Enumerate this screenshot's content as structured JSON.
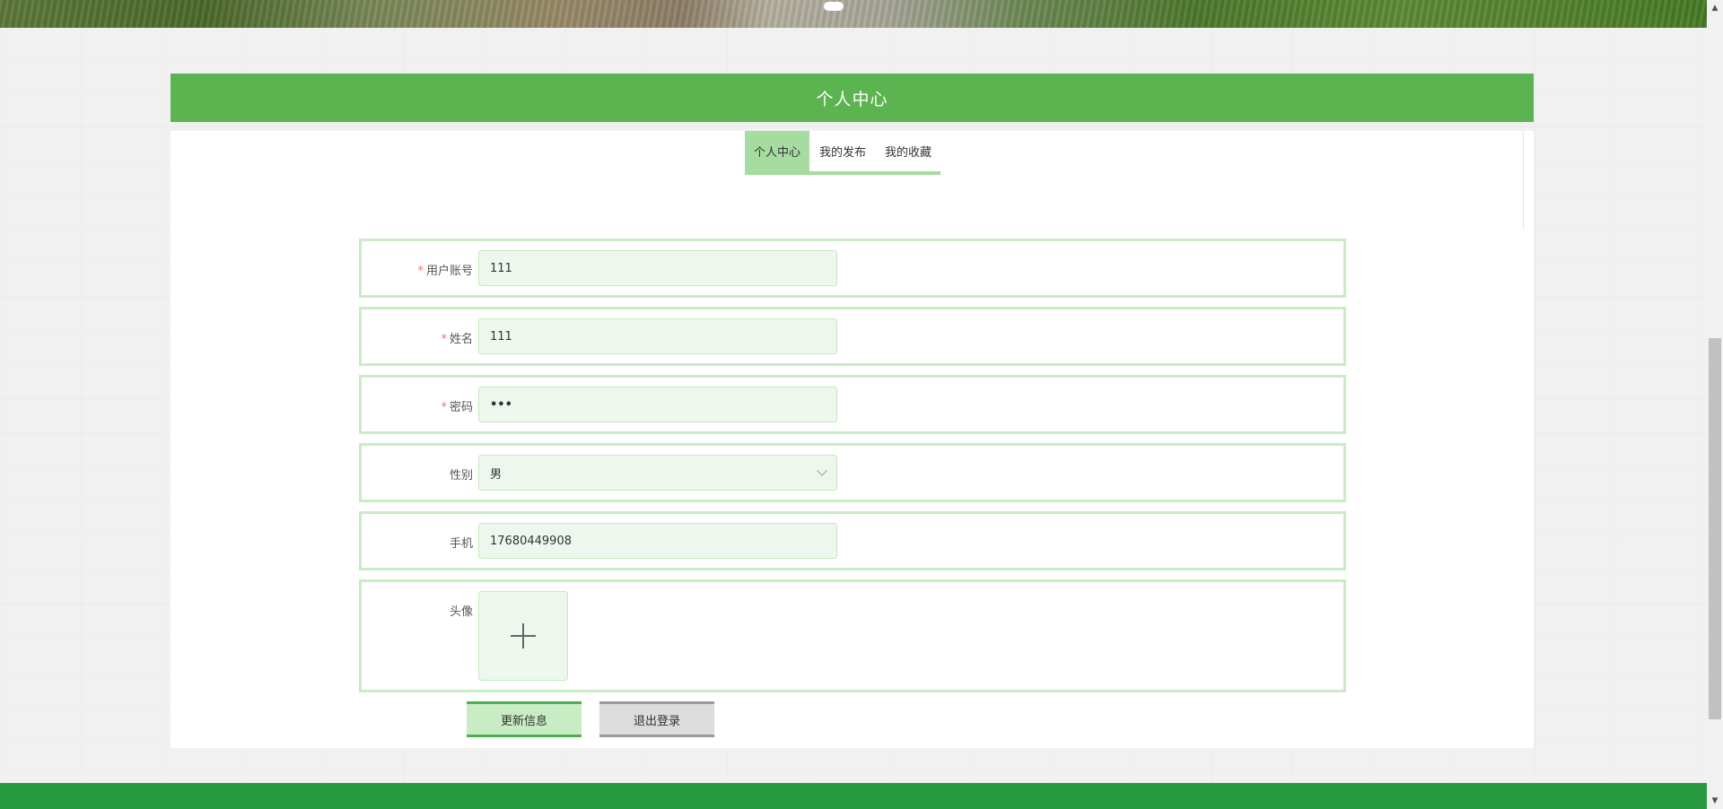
{
  "header": {
    "title": "个人中心"
  },
  "tabs": [
    {
      "label": "个人中心",
      "active": true
    },
    {
      "label": "我的发布",
      "active": false
    },
    {
      "label": "我的收藏",
      "active": false
    }
  ],
  "form": {
    "account": {
      "label": "用户账号",
      "required_mark": "*",
      "value": "111"
    },
    "name": {
      "label": "姓名",
      "required_mark": "*",
      "value": "111"
    },
    "password": {
      "label": "密码",
      "required_mark": "*",
      "value": "•••"
    },
    "gender": {
      "label": "性别",
      "value": "男"
    },
    "phone": {
      "label": "手机",
      "value": "17680449908"
    },
    "avatar": {
      "label": "头像"
    }
  },
  "buttons": {
    "update": "更新信息",
    "logout": "退出登录"
  },
  "scrollbar": {
    "up_glyph": "▲",
    "down_glyph": "▼"
  },
  "colors": {
    "header_bg": "#5cb450",
    "active_tab": "#a6dca0",
    "row_border": "#c8ecc4",
    "input_bg": "#eef7ee",
    "footer_bg": "#279a3f",
    "required": "#f56c6c"
  },
  "icons": {
    "avatar_upload": "plus-icon",
    "select_arrow": "chevron-down-icon"
  }
}
